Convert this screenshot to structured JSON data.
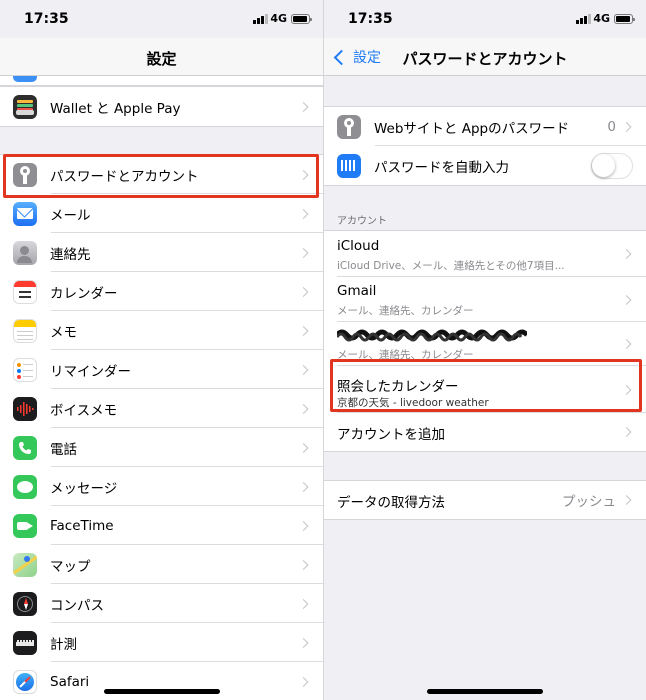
{
  "status": {
    "time": "17:35",
    "network": "4G",
    "battery_level": 0.9
  },
  "left": {
    "nav_title": "設定",
    "items": [
      {
        "label": "Wallet と Apple Pay",
        "icon": "wallet-icon",
        "color": "#2d2d2d"
      },
      {
        "label": "パスワードとアカウント",
        "icon": "key-icon",
        "color": "#8e8e93"
      },
      {
        "label": "メール",
        "icon": "mail-icon",
        "color": "#3c8ff5"
      },
      {
        "label": "連絡先",
        "icon": "contacts-icon",
        "color": "#b3b3b8"
      },
      {
        "label": "カレンダー",
        "icon": "calendar-icon",
        "color": "#ffffff"
      },
      {
        "label": "メモ",
        "icon": "notes-icon",
        "color": "#ffffff"
      },
      {
        "label": "リマインダー",
        "icon": "reminders-icon",
        "color": "#ffffff"
      },
      {
        "label": "ボイスメモ",
        "icon": "voice-memos-icon",
        "color": "#1c1c1e"
      },
      {
        "label": "電話",
        "icon": "phone-icon",
        "color": "#34c759"
      },
      {
        "label": "メッセージ",
        "icon": "messages-icon",
        "color": "#34c759"
      },
      {
        "label": "FaceTime",
        "icon": "facetime-icon",
        "color": "#34c759"
      },
      {
        "label": "マップ",
        "icon": "maps-icon",
        "color": "#a8d8a0"
      },
      {
        "label": "コンパス",
        "icon": "compass-icon",
        "color": "#1c1c1e"
      },
      {
        "label": "計測",
        "icon": "measure-icon",
        "color": "#1c1c1e"
      },
      {
        "label": "Safari",
        "icon": "safari-icon",
        "color": "#ffffff"
      }
    ]
  },
  "right": {
    "back_label": "設定",
    "nav_title": "パスワードとアカウント",
    "passwords_label": "Webサイトと Appのパスワード",
    "passwords_count": "0",
    "autofill_label": "パスワードを自動入力",
    "autofill_on": false,
    "accounts_header": "アカウント",
    "accounts": [
      {
        "title": "iCloud",
        "subtitle": "iCloud Drive、メール、連絡先とその他7項目..."
      },
      {
        "title": "Gmail",
        "subtitle": "メール、連絡先、カレンダー"
      },
      {
        "title": "",
        "subtitle": "メール、連絡先、カレンダー"
      },
      {
        "title": "照会したカレンダー",
        "subtitle": "京都の天気 - livedoor weather"
      }
    ],
    "add_account_label": "アカウントを追加",
    "fetch_label": "データの取得方法",
    "fetch_value": "プッシュ"
  },
  "colors": {
    "accent": "#1f7bf6",
    "highlight": "#e23520"
  }
}
